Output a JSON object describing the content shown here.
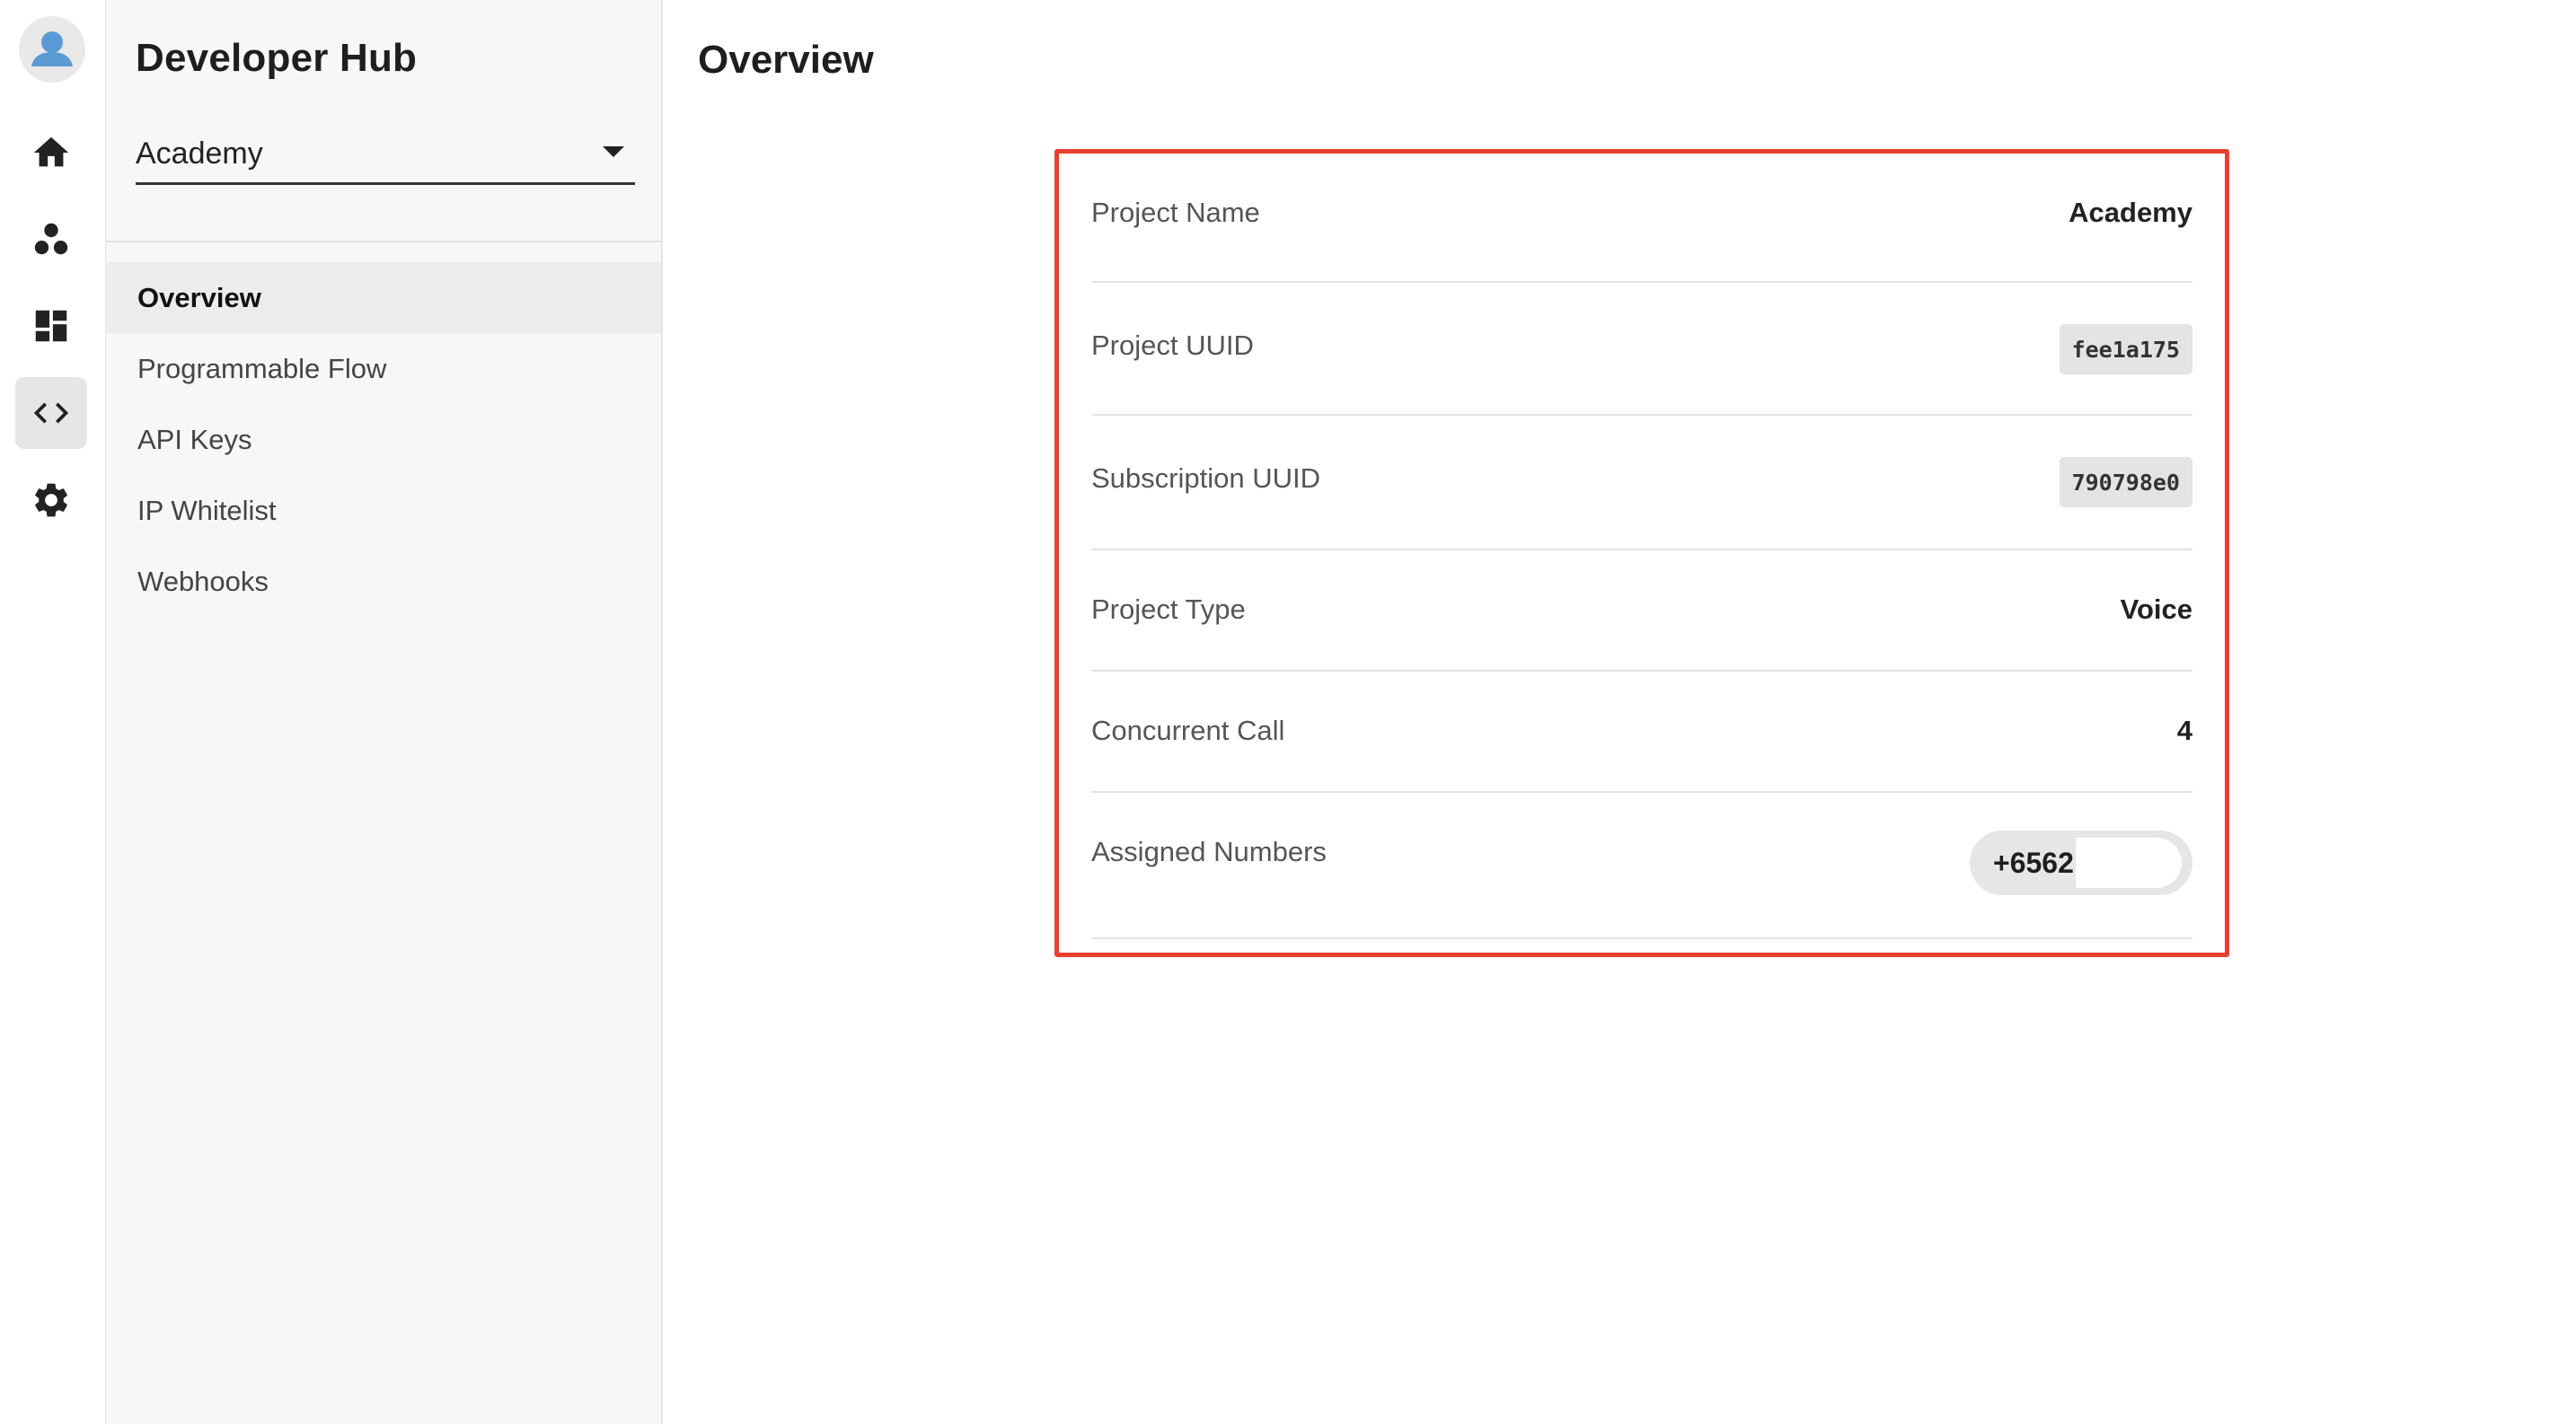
{
  "app": {
    "title": "Developer Hub"
  },
  "rail": {
    "items": [
      {
        "icon": "home-icon"
      },
      {
        "icon": "team-icon"
      },
      {
        "icon": "dashboard-icon"
      },
      {
        "icon": "code-icon",
        "active": true
      },
      {
        "icon": "gear-icon"
      }
    ]
  },
  "sidebar": {
    "project_select": {
      "value": "Academy"
    },
    "items": [
      {
        "label": "Overview",
        "active": true
      },
      {
        "label": "Programmable Flow"
      },
      {
        "label": "API Keys"
      },
      {
        "label": "IP Whitelist"
      },
      {
        "label": "Webhooks"
      }
    ]
  },
  "main": {
    "title": "Overview",
    "details": {
      "project_name": {
        "label": "Project Name",
        "value": "Academy"
      },
      "project_uuid": {
        "label": "Project UUID",
        "value": "fee1a175"
      },
      "subscription_uuid": {
        "label": "Subscription UUID",
        "value": "790798e0"
      },
      "project_type": {
        "label": "Project Type",
        "value": "Voice"
      },
      "concurrent_call": {
        "label": "Concurrent Call",
        "value": "4"
      },
      "assigned_numbers": {
        "label": "Assigned Numbers",
        "value": "+6562"
      }
    }
  },
  "colors": {
    "highlight_border": "#e8402e",
    "active_nav_bg": "#ececec",
    "avatar_blue": "#5b9bd5"
  }
}
